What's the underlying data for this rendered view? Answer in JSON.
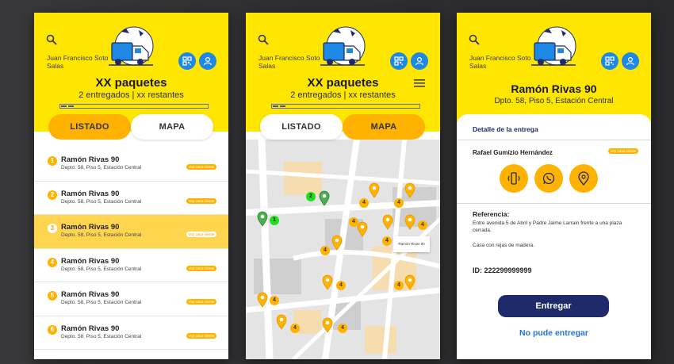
{
  "colors": {
    "yellow": "#ffe600",
    "amber": "#ffb300",
    "navy": "#1f2a6b",
    "blue": "#1e88e5",
    "green_pin": "#22dd22"
  },
  "header": {
    "user_name": "Juan Francisco Soto Salas",
    "title": "XX paquetes",
    "subtitle": "2 entregados | xx restantes"
  },
  "tabs": {
    "list": "LISTADO",
    "map": "MAPA"
  },
  "deliveries": [
    {
      "num": "1",
      "title": "Ramón Rivas 90",
      "address": "Depto. 58, Piso 5, Estación Central",
      "tag": "Voy casa cliente"
    },
    {
      "num": "2",
      "title": "Ramón Rivas 90",
      "address": "Depto. 58, Piso 5, Estación Central",
      "tag": "Voy casa cliente"
    },
    {
      "num": "3",
      "title": "Ramón Rivas 90",
      "address": "Depto. 58, Piso 5, Estación Central",
      "tag": "Voy casa cliente"
    },
    {
      "num": "4",
      "title": "Ramón Rivas 90",
      "address": "Depto. 58, Piso 5, Estación Central",
      "tag": "Voy casa cliente"
    },
    {
      "num": "5",
      "title": "Ramón Rivas 90",
      "address": "Depto. 58, Piso 5, Estación Central",
      "tag": "Voy casa cliente"
    },
    {
      "num": "6",
      "title": "Ramón Rivas 90",
      "address": "Depto. 58, Piso 5, Estación Central",
      "tag": "Voy casa cliente"
    }
  ],
  "map": {
    "label": "Ramón Rivas 90",
    "green_pins": [
      "1",
      "2"
    ],
    "amber_pin_number": "4"
  },
  "detail": {
    "title": "Ramón Rivas 90",
    "subtitle": "Dpto. 58, Piso 5, Estación Central",
    "section_header": "Detalle de la entrega",
    "person": "Rafael Gumízio Hernández",
    "tag": "Voy casa cliente",
    "reference_label": "Referencia:",
    "reference_text": "Entre avenida 5 de Abril y Padre Jaime Larrain frente a una plaza cerrada.",
    "reference_note": "Casa con rejas de madera.",
    "id_text": "ID: 222299999999",
    "primary_button": "Entregar",
    "secondary_button": "No pude entregar"
  }
}
